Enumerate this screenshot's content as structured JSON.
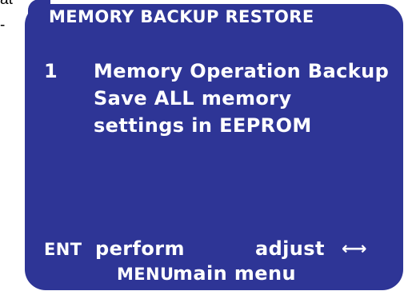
{
  "stray_text": {
    "top_fragment": "at",
    "dash_fragment": "-"
  },
  "screen": {
    "title": "MEMORY BACKUP RESTORE",
    "item": {
      "number": "1",
      "title": "Memory Operation Backup",
      "description_line1": "Save ALL memory",
      "description_line2": "settings in EEPROM"
    },
    "footer": {
      "perform_key": "ENT",
      "perform_label": "perform",
      "adjust_label": "adjust",
      "adjust_icon": "left-right-arrow-icon",
      "adjust_glyph": "⟷",
      "menu_key": "MENU",
      "menu_label": "main menu"
    }
  },
  "colors": {
    "screen_background": "#2e3596",
    "screen_text": "#ffffff",
    "page_background": "#ffffff"
  }
}
